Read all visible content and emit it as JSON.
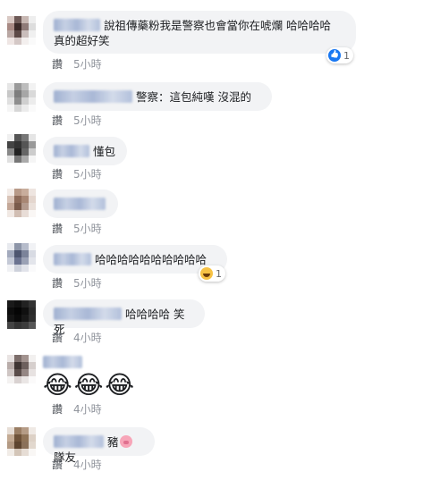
{
  "comments": [
    {
      "text_line1": "說祖傳藥粉我是警察也會當你在唬爛 哈哈哈哈",
      "text_line2": "真的超好笑",
      "like": "讚",
      "time": "5小時",
      "reaction_count": "1"
    },
    {
      "text": "警察：這包純嘆 沒混的",
      "like": "讚",
      "time": "5小時"
    },
    {
      "text": "懂包",
      "like": "讚",
      "time": "5小時"
    },
    {
      "text": "",
      "like": "讚",
      "time": "5小時"
    },
    {
      "text": "哈哈哈哈哈哈哈哈哈哈",
      "like": "讚",
      "time": "5小時",
      "reaction_count": "1"
    },
    {
      "text": "哈哈哈哈 笑死",
      "like": "讚",
      "time": "4小時"
    },
    {
      "emoji": "😂😂😂",
      "like": "讚",
      "time": "4小時"
    },
    {
      "text_before": "豬",
      "text_after": "隊友",
      "like": "讚",
      "time": "4小時"
    }
  ],
  "icons": {
    "like_reaction": "thumbs-up-icon",
    "haha_reaction": "laughing-emoji-icon",
    "pig": "pig-emoji-icon"
  },
  "colors": {
    "bubble": "#f2f3f5",
    "like_blue": "#1877f2",
    "meta_text": "#4b4f56"
  }
}
